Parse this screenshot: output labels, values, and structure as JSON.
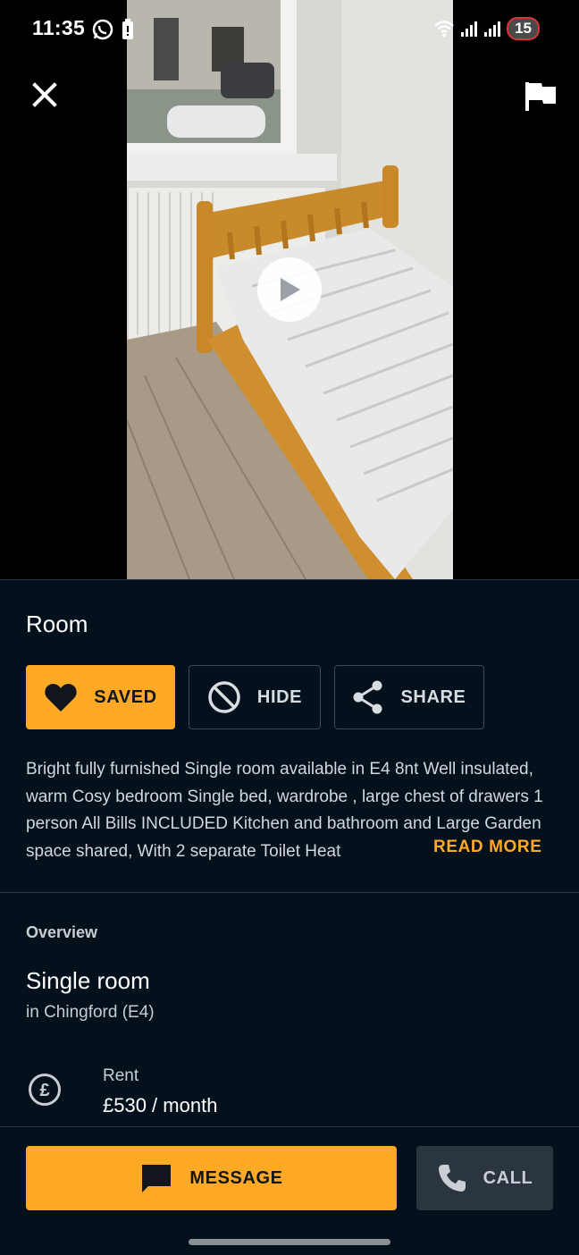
{
  "status_bar": {
    "time": "11:35",
    "notification_count": "15",
    "icons": [
      "whatsapp-icon",
      "battery-saver-icon",
      "wifi-icon",
      "signal-icon",
      "signal-icon"
    ]
  },
  "media": {
    "close_icon": "close-icon",
    "report_icon": "flag-icon",
    "play_icon": "play-icon"
  },
  "listing": {
    "category": "Room",
    "actions": {
      "saved_label": "SAVED",
      "hide_label": "HIDE",
      "share_label": "SHARE"
    },
    "description": "Bright fully furnished Single room available in E4 8nt Well insulated, warm Cosy bedroom Single bed, wardrobe , large chest of drawers 1 person All Bills INCLUDED Kitchen and bathroom and Large Garden space shared, With 2 separate Toilet Heat",
    "read_more_label": "READ MORE"
  },
  "overview": {
    "section_label": "Overview",
    "room_type": "Single room",
    "location": "in Chingford (E4)",
    "rent_label": "Rent",
    "rent_value": "£530 / month"
  },
  "bottom_bar": {
    "message_label": "MESSAGE",
    "call_label": "CALL"
  },
  "colors": {
    "accent": "#ffa927",
    "background": "#04111d",
    "secondary_button": "#2a3540"
  }
}
